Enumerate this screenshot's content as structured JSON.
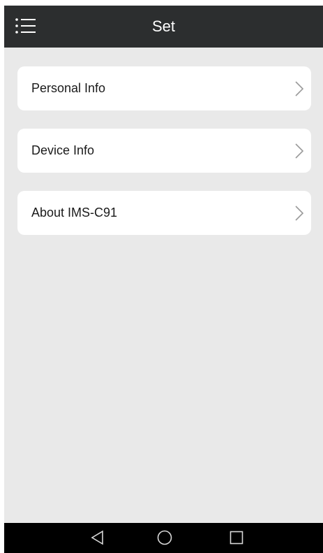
{
  "header": {
    "title": "Set",
    "menu_icon": "menu-list-icon"
  },
  "items": [
    {
      "label": "Personal Info",
      "icon": "chevron-right-icon"
    },
    {
      "label": "Device Info",
      "icon": "chevron-right-icon"
    },
    {
      "label": "About IMS-C91",
      "icon": "chevron-right-icon"
    }
  ],
  "navbar": {
    "back_icon": "back-triangle-icon",
    "home_icon": "home-circle-icon",
    "recent_icon": "recent-apps-square-icon"
  },
  "colors": {
    "topbar": "#2c2e2f",
    "background": "#e9e9e9",
    "card": "#ffffff",
    "navbar": "#000000"
  }
}
